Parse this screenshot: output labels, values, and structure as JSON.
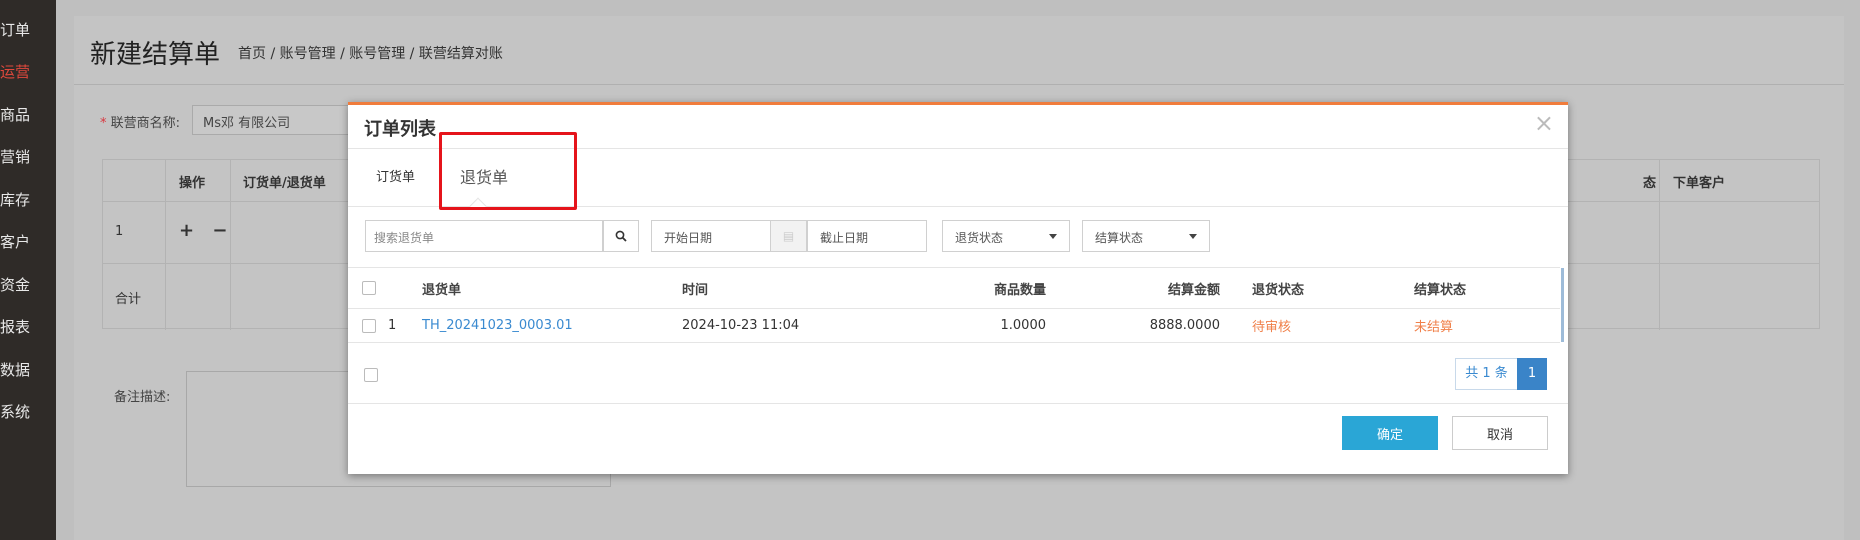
{
  "sidebar": {
    "items": [
      {
        "label": "订单"
      },
      {
        "label": "运营"
      },
      {
        "label": "商品"
      },
      {
        "label": "营销"
      },
      {
        "label": "库存"
      },
      {
        "label": "客户"
      },
      {
        "label": "资金"
      },
      {
        "label": "报表"
      },
      {
        "label": "数据"
      },
      {
        "label": "系统"
      }
    ],
    "active_color": "#e0483c"
  },
  "page": {
    "title": "新建结算单",
    "breadcrumb": "首页 / 账号管理 / 账号管理 / 联营结算对账",
    "partner_label": "联营商名称:",
    "partner_value": "Ms邓 有限公司",
    "table_headers": [
      "操作",
      "订货单/退货单",
      "态",
      "下单客户"
    ],
    "row_index": "1",
    "row_ops": "+ −",
    "total_label": "合计",
    "remark_label": "备注描述:"
  },
  "modal": {
    "title": "订单列表",
    "close_icon": "close-icon",
    "accent_color": "#f07c3c",
    "tabs": [
      {
        "label": "订货单"
      },
      {
        "label": "退货单"
      }
    ],
    "active_tab": "退货单",
    "filters": {
      "search_placeholder": "搜索退货单",
      "date_start": "开始日期",
      "date_end": "截止日期",
      "return_status": "退货状态",
      "settle_status": "结算状态"
    },
    "columns": [
      "退货单",
      "时间",
      "商品数量",
      "结算金额",
      "退货状态",
      "结算状态"
    ],
    "rows": [
      {
        "index": "1",
        "return_no": "TH_20241023_0003.01",
        "time": "2024-10-23 11:04",
        "qty": "1.0000",
        "amount": "8888.0000",
        "return_status": "待审核",
        "settle_status": "未结算"
      }
    ],
    "pager": {
      "total": "共 1 条",
      "page": "1"
    },
    "confirm_label": "确定",
    "cancel_label": "取消"
  }
}
